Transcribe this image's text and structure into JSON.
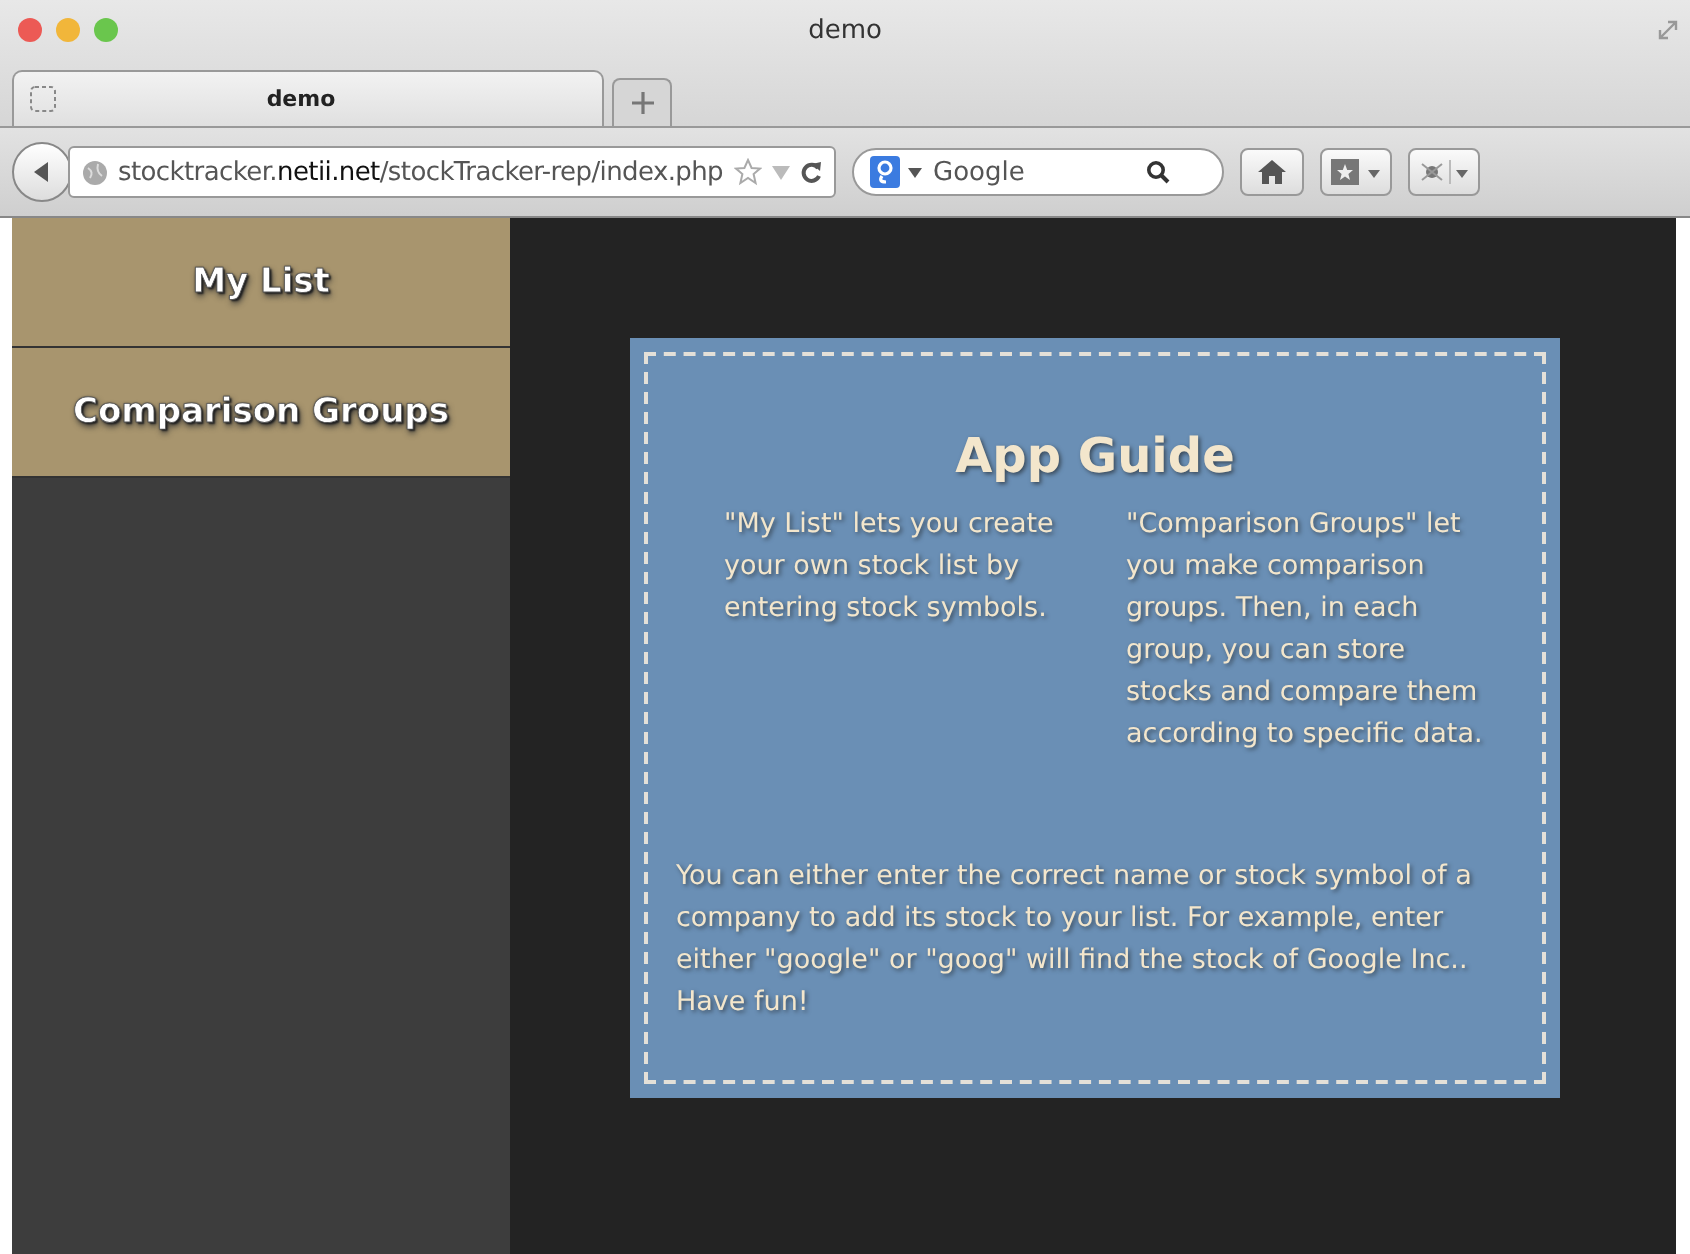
{
  "window": {
    "title": "demo"
  },
  "tabs": [
    {
      "label": "demo",
      "selected": true
    }
  ],
  "toolbar": {
    "url": "stocktracker.**netii.net**/stockTracker-rep/index.php",
    "search": {
      "placeholder": "Google"
    }
  },
  "sidebar": {
    "items": [
      {
        "label": "My List"
      },
      {
        "label": "Comparison Groups"
      }
    ]
  },
  "guide": {
    "title": "App Guide",
    "columns": [
      "\"My List\" lets you create your own stock list by entering stock symbols.",
      "\"Comparison Groups\" let you make comparison groups. Then, in each group, you can store stocks and compare them according to specific data."
    ],
    "footer": "You can either enter the correct name or stock symbol of a company to add its stock to your list. For example, enter either \"google\" or \"goog\" will find the stock of Google Inc.. Have fun!"
  }
}
